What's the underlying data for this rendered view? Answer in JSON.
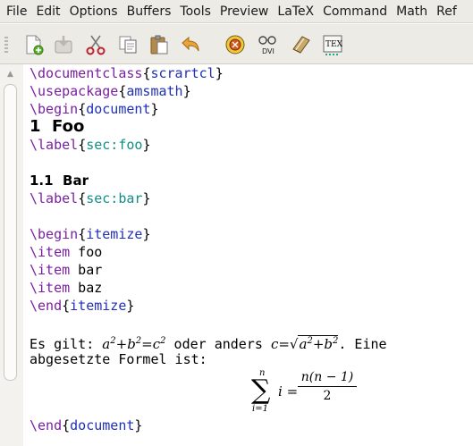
{
  "menu": [
    "File",
    "Edit",
    "Options",
    "Buffers",
    "Tools",
    "Preview",
    "LaTeX",
    "Command",
    "Math",
    "Ref"
  ],
  "toolbar": {
    "icons": [
      "new-file-icon",
      "save-icon",
      "cut-icon",
      "copy-icon",
      "paste-icon",
      "undo-icon",
      "latex-run-icon",
      "view-dvi-icon",
      "bibtex-icon",
      "texify-icon"
    ],
    "dvi_label": "DVI",
    "tex_label": "TEX"
  },
  "editor": {
    "l1": {
      "cmd": "\\documentclass",
      "open": "{",
      "arg": "scrartcl",
      "close": "}"
    },
    "l2": {
      "cmd": "\\usepackage",
      "open": "{",
      "arg": "amsmath",
      "close": "}"
    },
    "l3": {
      "cmd": "\\begin",
      "open": "{",
      "arg": "document",
      "close": "}"
    },
    "section": "1  Foo",
    "label1": {
      "cmd": "\\label",
      "open": "{",
      "arg": "sec:foo",
      "close": "}"
    },
    "subsection": "1.1  Bar",
    "label2": {
      "cmd": "\\label",
      "open": "{",
      "arg": "sec:bar",
      "close": "}"
    },
    "begin_itemize": {
      "cmd": "\\begin",
      "open": "{",
      "arg": "itemize",
      "close": "}"
    },
    "items": [
      {
        "cmd": "\\item",
        "text": " foo"
      },
      {
        "cmd": "\\item",
        "text": " bar"
      },
      {
        "cmd": "\\item",
        "text": " baz"
      }
    ],
    "end_itemize": {
      "cmd": "\\end",
      "open": "{",
      "arg": "itemize",
      "close": "}"
    },
    "para_start": "Es gilt: ",
    "para_mid": " oder anders ",
    "para_end": ". Eine",
    "para_line2": "abgesetzte Formel ist:",
    "end_document": {
      "cmd": "\\end",
      "open": "{",
      "arg": "document",
      "close": "}"
    }
  },
  "colors": {
    "command": "#7a1fa2",
    "argument_blue": "#1f2fb8",
    "argument_teal": "#0f8f86",
    "toolbar_bg": "#ecebe6"
  }
}
